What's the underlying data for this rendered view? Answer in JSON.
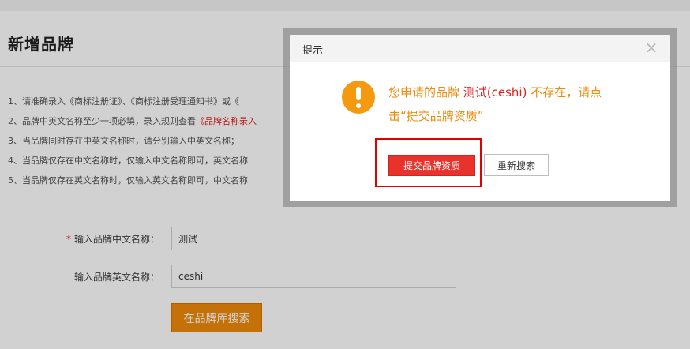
{
  "page": {
    "title": "新增品牌",
    "rules": [
      {
        "text": "1、请准确录入《商标注册证》、《商标注册受理通知书》或《",
        "red": ""
      },
      {
        "text": "2、品牌中英文名称至少一项必填，录入规则查看",
        "red": "《品牌名称录入"
      },
      {
        "text": "3、当品牌同时存在中英文名称时，请分别输入中英文名称；",
        "red": ""
      },
      {
        "text": "4、当品牌仅存在中文名称时，仅输入中文名称即可，英文名称",
        "red": ""
      },
      {
        "text": "5、当品牌仅存在英文名称时，仅输入英文名称即可，中文名称",
        "red": ""
      }
    ]
  },
  "form": {
    "cn_required_mark": "*",
    "cn_label": "输入品牌中文名称：",
    "cn_value": "测试",
    "en_label": "输入品牌英文名称：",
    "en_value": "ceshi",
    "search_button": "在品牌库搜索"
  },
  "dialog": {
    "title": "提示",
    "close_symbol": "×",
    "message_prefix": "您申请的品牌 ",
    "brand_name": "测试(ceshi)",
    "message_suffix": " 不存在，请点击“提交品牌资质”",
    "submit_button": "提交品牌资质",
    "research_button": "重新搜索"
  },
  "colors": {
    "accent_orange": "#f08a0a",
    "danger_red": "#e8322b",
    "highlight_red": "#e00000",
    "warning_icon": "#f59a10"
  },
  "icons": {
    "warning": "exclamation-circle-icon",
    "close": "close-icon"
  }
}
